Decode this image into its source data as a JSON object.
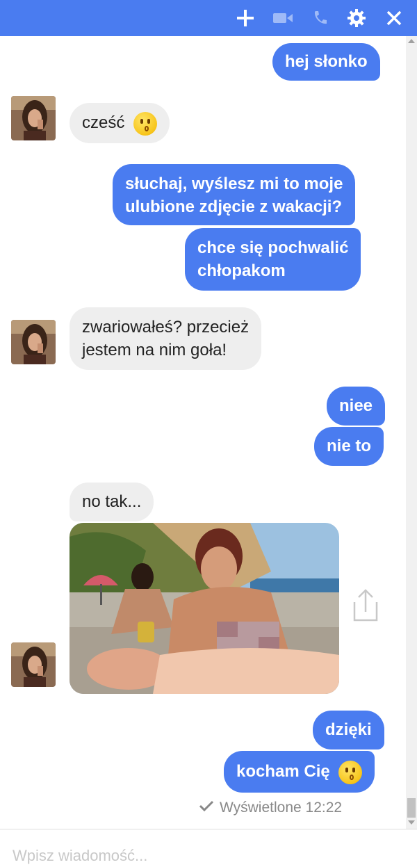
{
  "header": {
    "background": "#4a7cf0",
    "icons": [
      "plus-icon",
      "video-icon",
      "phone-icon",
      "gear-icon",
      "close-icon"
    ]
  },
  "messages": [
    {
      "from": "me",
      "text": "hej słonko"
    },
    {
      "from": "her",
      "text": "cześć",
      "emoji": "kissing-face"
    },
    {
      "from": "me",
      "lines": [
        "słuchaj, wyślesz mi to moje",
        "ulubione zdjęcie z wakacji?"
      ]
    },
    {
      "from": "me",
      "lines": [
        "chce się pochwalić",
        "chłopakom"
      ]
    },
    {
      "from": "her",
      "lines": [
        "zwariowałeś? przecież",
        "jestem na nim goła!"
      ]
    },
    {
      "from": "me",
      "text": "niee"
    },
    {
      "from": "me",
      "text": "nie to"
    },
    {
      "from": "her",
      "text": "no tak..."
    },
    {
      "from": "her",
      "type": "photo",
      "description": "beach photo attachment"
    },
    {
      "from": "me",
      "text": "dzięki"
    },
    {
      "from": "me",
      "text": "kocham Cię",
      "emoji": "kissing-face"
    }
  ],
  "status": {
    "seen": "Wyświetlone 12:22"
  },
  "composer": {
    "placeholder": "Wpisz wiadomość..."
  },
  "colors": {
    "outgoing": "#4a7cf0",
    "incoming": "#eeeeee"
  }
}
